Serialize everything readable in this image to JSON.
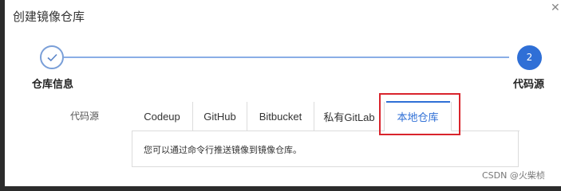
{
  "dialog": {
    "title": "创建镜像仓库"
  },
  "steps": {
    "step1": {
      "label": "仓库信息",
      "status": "done",
      "icon": "check-icon"
    },
    "step2": {
      "label": "代码源",
      "number": "2"
    }
  },
  "form": {
    "source_label": "代码源",
    "tabs": [
      {
        "label": "Codeup"
      },
      {
        "label": "GitHub"
      },
      {
        "label": "Bitbucket"
      },
      {
        "label": "私有GitLab"
      },
      {
        "label": "本地仓库"
      }
    ],
    "active_tab": "本地仓库",
    "tab_content": "您可以通过命令行推送镜像到镜像仓库。"
  },
  "watermark": "CSDN @火柴桢",
  "colors": {
    "accent": "#2f6fd6",
    "highlight": "#d9242c"
  }
}
